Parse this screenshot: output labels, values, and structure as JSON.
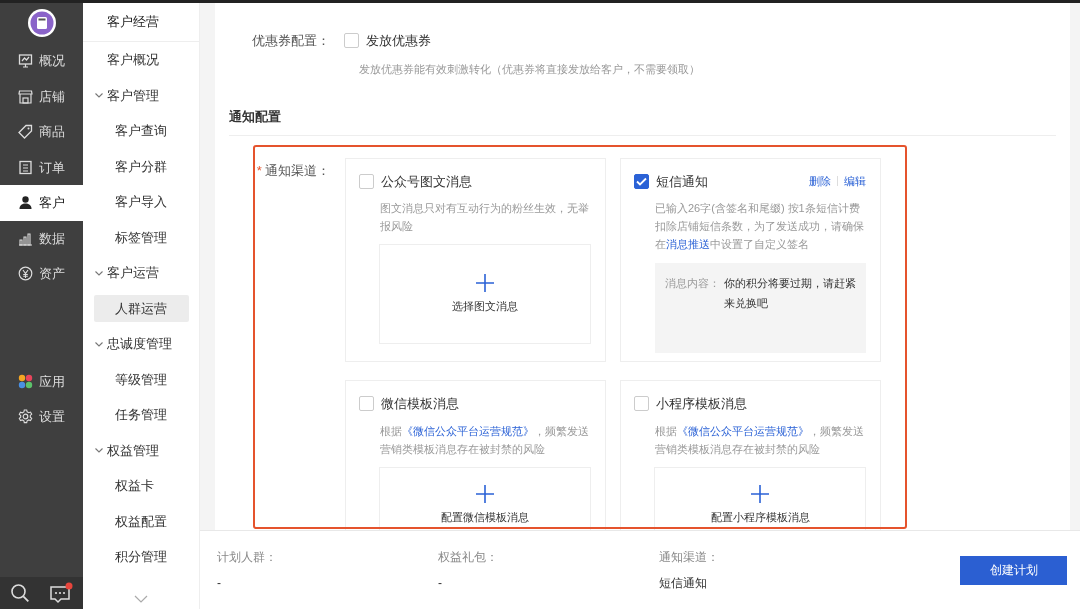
{
  "nav": {
    "items": [
      {
        "label": "概况",
        "selected": false
      },
      {
        "label": "店铺",
        "selected": false
      },
      {
        "label": "商品",
        "selected": false
      },
      {
        "label": "订单",
        "selected": false
      },
      {
        "label": "客户",
        "selected": true
      },
      {
        "label": "数据",
        "selected": false
      },
      {
        "label": "资产",
        "selected": false
      }
    ],
    "extra": [
      {
        "label": "应用",
        "selected": false
      },
      {
        "label": "设置",
        "selected": false
      }
    ],
    "messages_unread": true
  },
  "subnav": {
    "title": "客户经营",
    "items": [
      {
        "label": "客户概况",
        "selected": false
      },
      {
        "label": "客户管理",
        "expanded": true,
        "children": [
          {
            "label": "客户查询",
            "selected": false
          },
          {
            "label": "客户分群",
            "selected": false
          },
          {
            "label": "客户导入",
            "selected": false
          },
          {
            "label": "标签管理",
            "selected": false
          }
        ]
      },
      {
        "label": "客户运营",
        "expanded": true,
        "children": [
          {
            "label": "人群运营",
            "selected": true
          }
        ]
      },
      {
        "label": "忠诚度管理",
        "expanded": true,
        "children": [
          {
            "label": "等级管理",
            "selected": false
          },
          {
            "label": "任务管理",
            "selected": false
          }
        ]
      },
      {
        "label": "权益管理",
        "expanded": true,
        "children": [
          {
            "label": "权益卡",
            "selected": false
          },
          {
            "label": "权益配置",
            "selected": false
          },
          {
            "label": "积分管理",
            "selected": false
          }
        ]
      }
    ]
  },
  "coupon": {
    "label": "优惠券配置：",
    "option": "发放优惠券",
    "checked": false,
    "hint": "发放优惠券能有效刺激转化（优惠券将直接发放给客户，不需要领取）"
  },
  "notify": {
    "section": "通知配置",
    "required_mark": "*",
    "label": "通知渠道：",
    "channels": [
      {
        "kind": "picker",
        "title": "公众号图文消息",
        "checked": false,
        "desc": [
          {
            "text": "图文消息只对有互动行为的粉丝生效，无举报风险"
          }
        ],
        "picker": "选择图文消息"
      },
      {
        "kind": "sms",
        "title": "短信通知",
        "checked": true,
        "actions": [
          "删除",
          "编辑"
        ],
        "desc": [
          {
            "text": "已输入26字(含签名和尾缀) 按1条短信计费扣除店铺短信条数，为了发送成功，请确保在"
          },
          {
            "text": "消息推送",
            "link": true
          },
          {
            "text": "中设置了自定义签名"
          }
        ],
        "message_label": "消息内容：",
        "message": "你的积分将要过期，请赶紧来兑换吧"
      },
      {
        "kind": "picker",
        "title": "微信模板消息",
        "checked": false,
        "desc": [
          {
            "text": "根据"
          },
          {
            "text": "《微信公众平台运营规范》",
            "link": true
          },
          {
            "text": "，频繁发送营销类模板消息存在被封禁的风险"
          }
        ],
        "picker": "配置微信模板消息"
      },
      {
        "kind": "picker",
        "title": "小程序模板消息",
        "checked": false,
        "desc": [
          {
            "text": "根据"
          },
          {
            "text": "《微信公众平台运营规范》",
            "link": true
          },
          {
            "text": "，频繁发送营销类模板消息存在被封禁的风险"
          }
        ],
        "picker": "配置小程序模板消息"
      }
    ]
  },
  "footer": {
    "fields": [
      {
        "label": "计划人群：",
        "value": "-"
      },
      {
        "label": "权益礼包：",
        "value": "-"
      },
      {
        "label": "通知渠道：",
        "value": "短信通知"
      }
    ],
    "button": "创建计划"
  }
}
